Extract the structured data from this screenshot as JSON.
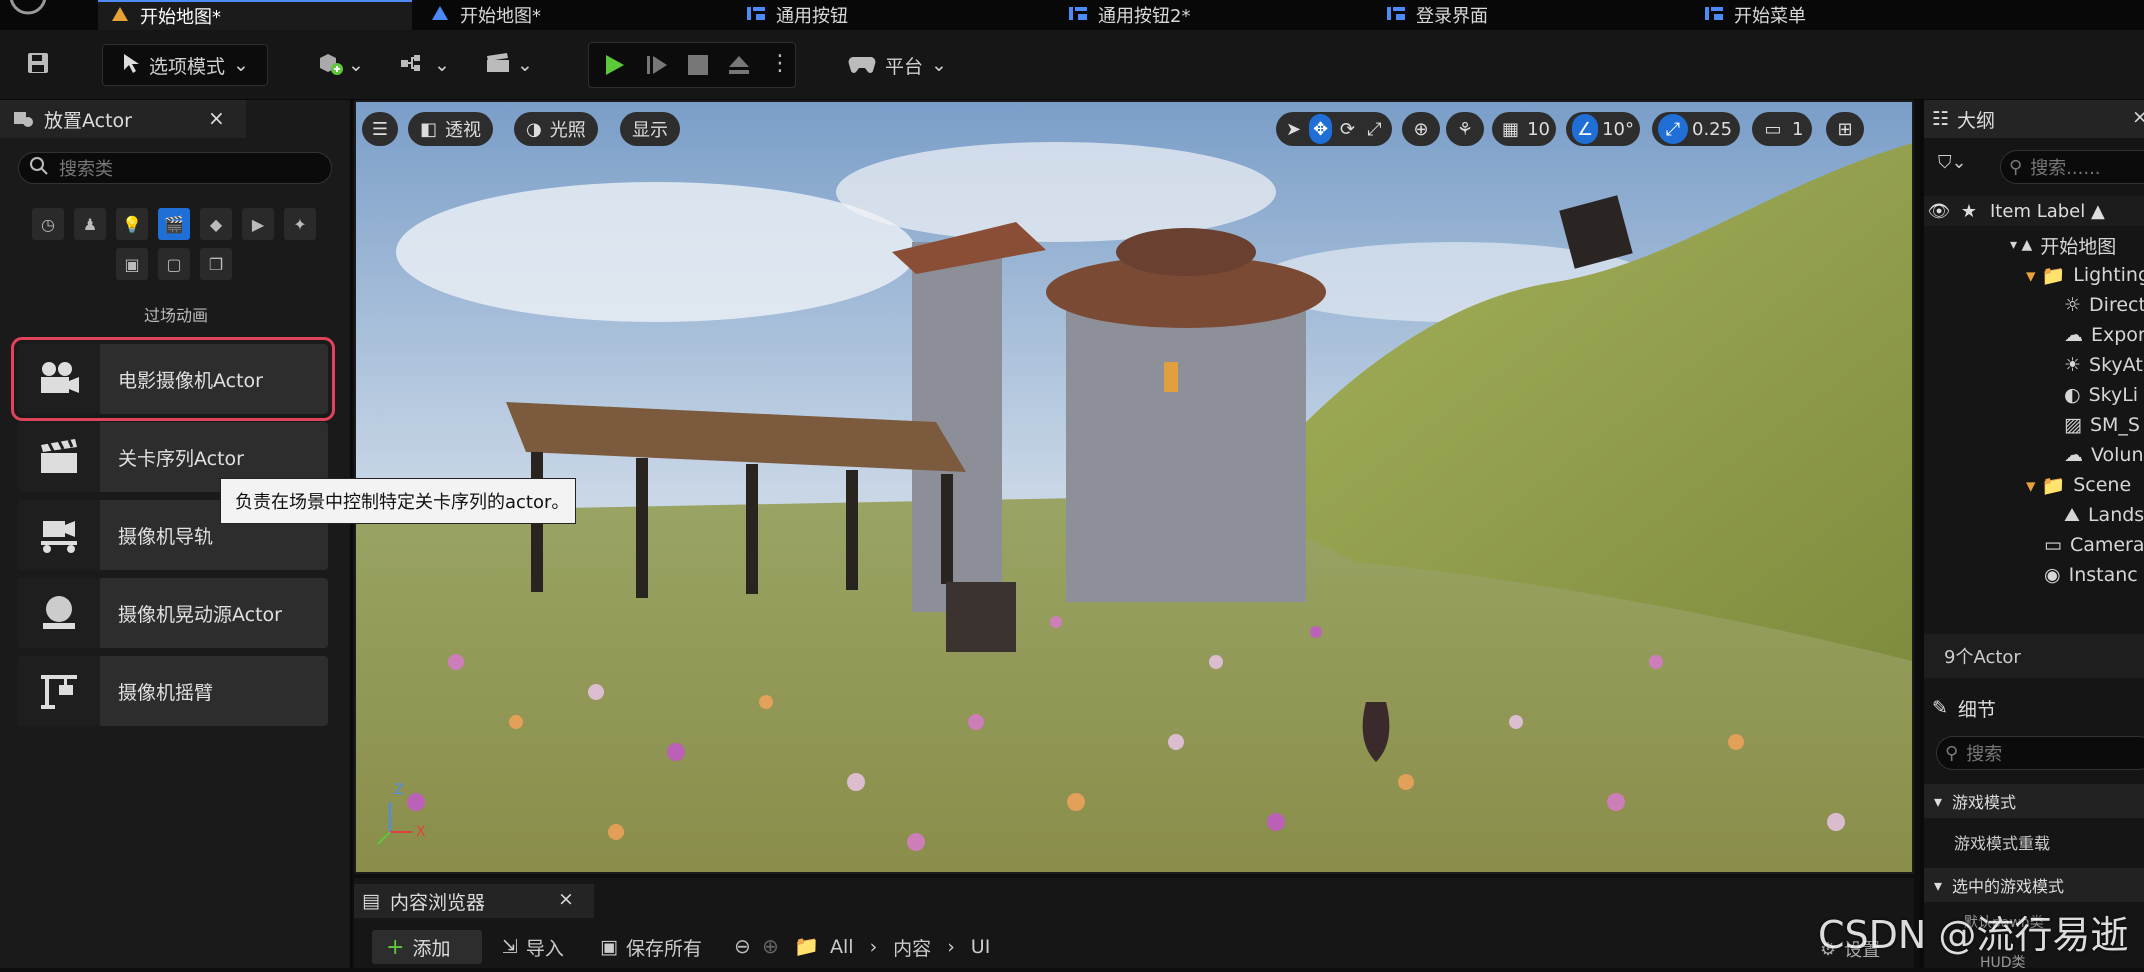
{
  "tabs": [
    {
      "label": "开始地图*",
      "active": true
    },
    {
      "label": "开始地图*",
      "active": false
    },
    {
      "label": "通用按钮",
      "active": false
    },
    {
      "label": "通用按钮2*",
      "active": false
    },
    {
      "label": "登录界面",
      "active": false
    },
    {
      "label": "开始菜单",
      "active": false
    }
  ],
  "toolbar": {
    "mode_label": "选项模式",
    "platform_label": "平台"
  },
  "place_actor": {
    "title": "放置Actor",
    "close": "×",
    "search_placeholder": "搜索类",
    "category_label": "过场动画",
    "items": [
      {
        "label": "电影摄像机Actor",
        "icon": "cine-camera-icon",
        "highlighted": true
      },
      {
        "label": "关卡序列Actor",
        "icon": "clapperboard-icon",
        "highlighted": false
      },
      {
        "label": "摄像机导轨",
        "icon": "camera-rig-rail-icon",
        "highlighted": false
      },
      {
        "label": "摄像机晃动源Actor",
        "icon": "camera-shake-source-icon",
        "highlighted": false
      },
      {
        "label": "摄像机摇臂",
        "icon": "camera-crane-icon",
        "highlighted": false
      }
    ],
    "tooltip": "负责在场景中控制特定关卡序列的actor。"
  },
  "viewport": {
    "perspective": "透视",
    "lit": "光照",
    "show": "显示",
    "grid_snap": "10",
    "rotation_snap": "10°",
    "scale_snap": "0.25",
    "camera_speed": "1"
  },
  "outliner": {
    "title": "大纲",
    "close": "×",
    "search_placeholder": "搜索......",
    "column_header": "Item Label ▲",
    "tree": [
      {
        "label": "开始地图",
        "indent": 1
      },
      {
        "label": "Lighting",
        "indent": 2
      },
      {
        "label": "Direct",
        "indent": 3
      },
      {
        "label": "Expon",
        "indent": 3
      },
      {
        "label": "SkyAt",
        "indent": 3
      },
      {
        "label": "SkyLi",
        "indent": 3
      },
      {
        "label": "SM_S",
        "indent": 3
      },
      {
        "label": "Volun",
        "indent": 3
      },
      {
        "label": "Scene",
        "indent": 2
      },
      {
        "label": "Lands",
        "indent": 3
      },
      {
        "label": "Camera",
        "indent": 2
      },
      {
        "label": "Instanc",
        "indent": 2
      }
    ],
    "actor_count": "9个Actor"
  },
  "details": {
    "title": "细节",
    "search_placeholder": "搜索",
    "section_game_mode": "游戏模式",
    "override_label": "游戏模式重载",
    "section_selected": "选中的游戏模式",
    "pawn_label": "默认pawn类",
    "hud_label": "HUD类"
  },
  "content_browser": {
    "title": "内容浏览器",
    "close": "×",
    "add": "添加",
    "import": "导入",
    "save_all": "保存所有",
    "crumbs": [
      "All",
      "内容",
      "UI"
    ],
    "settings": "设置"
  },
  "watermark": "CSDN @流行易逝",
  "colors": {
    "accent": "#1f6fd6",
    "highlight": "#e0435a",
    "play": "#5cc83a"
  }
}
